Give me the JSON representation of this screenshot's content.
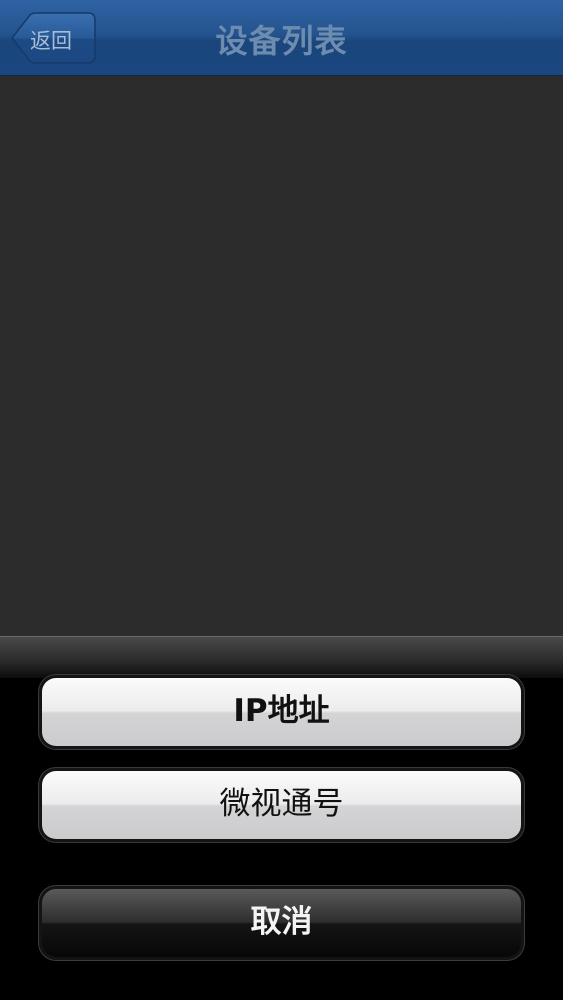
{
  "nav": {
    "title": "设备列表",
    "back_label": "返回"
  },
  "action_sheet": {
    "options": [
      {
        "label": "IP地址"
      },
      {
        "label": "微视通号"
      }
    ],
    "cancel_label": "取消"
  },
  "colors": {
    "navbar": "#24548f",
    "content_bg": "#2d2c2d",
    "sheet_bg": "#000000",
    "light_button": "#ececec",
    "dark_button": "#1a1a1a"
  }
}
